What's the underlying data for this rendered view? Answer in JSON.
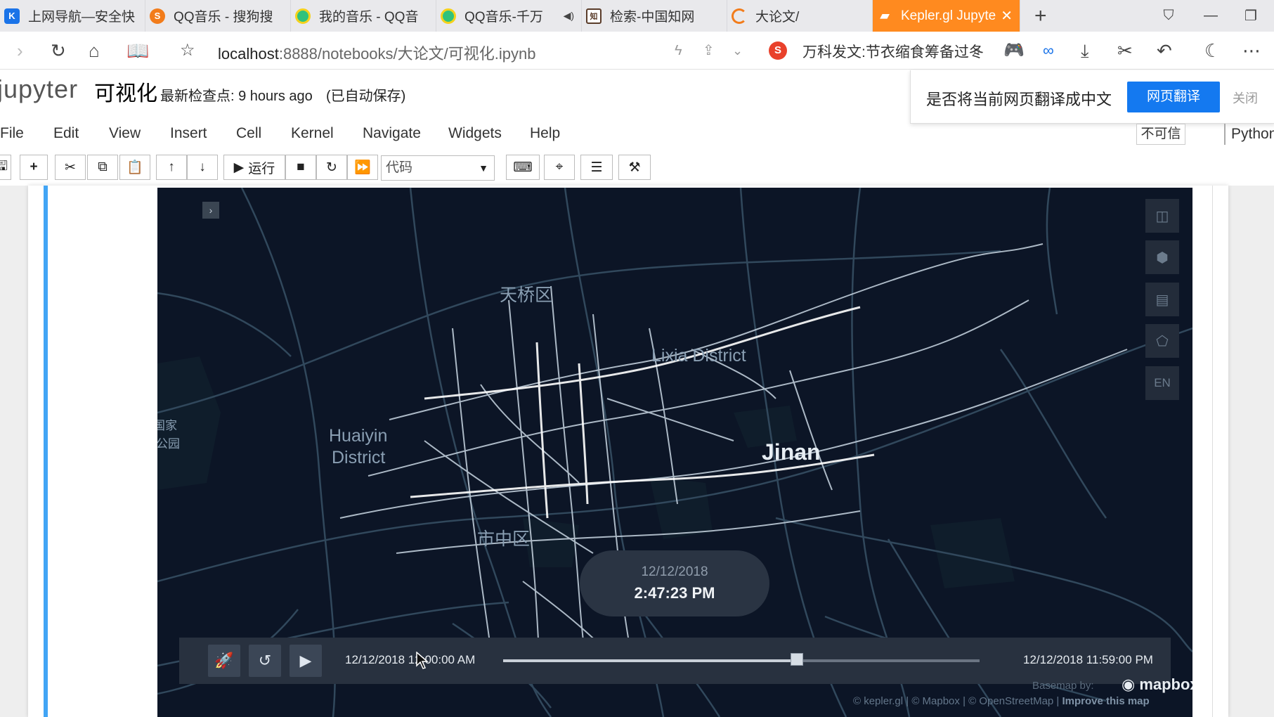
{
  "browser": {
    "tabs": [
      {
        "title": "上网导航—安全快",
        "favicon": "shield-k-icon",
        "color": "#1a73e8",
        "active": false
      },
      {
        "title": "QQ音乐 - 搜狗搜",
        "favicon": "sogou-icon",
        "color": "#f27c1b",
        "active": false
      },
      {
        "title": "我的音乐 - QQ音",
        "favicon": "qqmusic-icon",
        "color": "#31c27c",
        "active": false
      },
      {
        "title": "QQ音乐-千万",
        "favicon": "qqmusic-icon",
        "color": "#31c27c",
        "active": false,
        "audio": true
      },
      {
        "title": "检索-中国知网",
        "favicon": "cnki-icon",
        "color": "#5a3c2a",
        "active": false
      },
      {
        "title": "大论文/",
        "favicon": "loading-icon",
        "color": "#f27c1b",
        "active": false
      },
      {
        "title": "Kepler.gl Jupyte",
        "favicon": "notebook-icon",
        "color": "#ffffff",
        "active": true
      }
    ],
    "new_tab": "+",
    "url_host": "localhost",
    "url_path": ":8888/notebooks/大论文/可视化.ipynb",
    "search_text": "万科发文:节衣缩食筹备过冬",
    "accent": "#ff8a1f"
  },
  "jupyter": {
    "logo_text": "jupyter",
    "notebook_name": "可视化",
    "checkpoint": "最新检查点: 9 hours ago",
    "autosave": "(已自动保存)",
    "menus": [
      "File",
      "Edit",
      "View",
      "Insert",
      "Cell",
      "Kernel",
      "Navigate",
      "Widgets",
      "Help"
    ],
    "trust": "不可信",
    "kernel": "Python",
    "run_label": "运行",
    "cell_type": "代码",
    "cell_accent": "#42a5f5"
  },
  "translate": {
    "question": "是否将当前网页翻译成中文",
    "button": "网页翻译",
    "close": "关闭"
  },
  "map": {
    "labels": {
      "tianqiao": "天桥区",
      "lixia": "Lixia District",
      "huaiyin_1": "Huaiyin",
      "huaiyin_2": "District",
      "shizhong": "市中区",
      "jinan": "Jinan",
      "park_1": "国家",
      "park_2": "公园"
    },
    "controls": {
      "language": "EN"
    },
    "time_bubble": {
      "date": "12/12/2018",
      "time": "2:47:23 PM"
    },
    "time_range": {
      "start": "12/12/2018 12:00:00 AM",
      "end": "12/12/2018 11:59:00 PM",
      "progress": 0.617
    },
    "attribution": {
      "basemap": "Basemap by:",
      "mapbox": "mapbox",
      "credits": "© kepler.gl | © Mapbox | © OpenStreetMap | ",
      "improve": "Improve this map"
    },
    "background": "#0c1526"
  }
}
